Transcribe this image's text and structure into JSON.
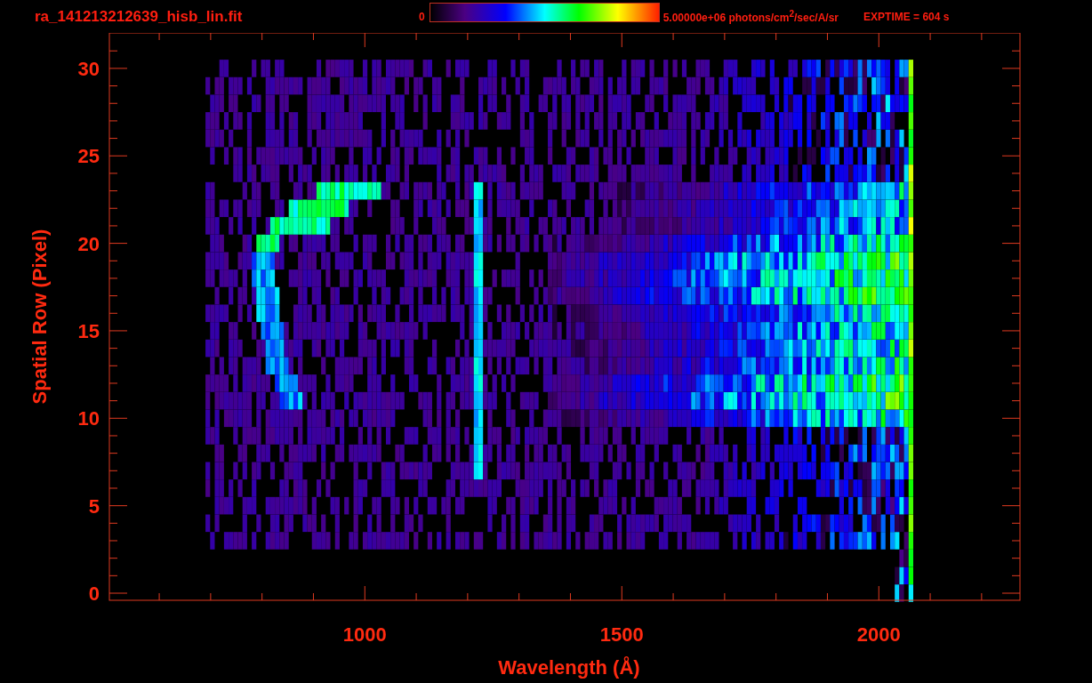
{
  "title": "ra_141213212639_hisb_lin.fit",
  "colorbar": {
    "min_label": "0",
    "max_label": "5.00000e+06 photons/cm$^{2}$/sec/A/sr"
  },
  "exposure": "EXPTIME = 604 s",
  "plot": {
    "y_label": "Spatial Row (Pixel)",
    "y_ticks": [
      "30",
      "25",
      "20",
      "15",
      "10",
      "5",
      "0"
    ],
    "x_label": "Wavelength (Å)",
    "x_ticks": [
      "1000",
      "1500",
      "2000"
    ]
  }
}
